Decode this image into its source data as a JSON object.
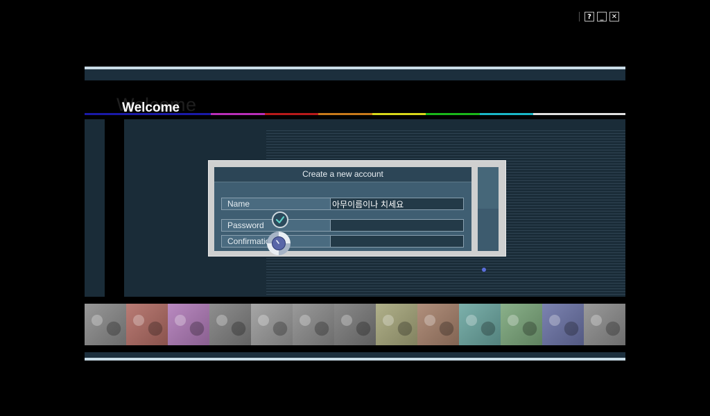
{
  "window_controls": [
    {
      "name": "help-button",
      "label": "?"
    },
    {
      "name": "minimize-button",
      "label": "_"
    },
    {
      "name": "close-button",
      "label": "✕"
    }
  ],
  "welcome": {
    "ghost_text": "Welcome",
    "title": "Welcome"
  },
  "rainbow_colors": [
    "#1a1aa8",
    "#1a1aa8",
    "#b82eb8",
    "#b81a1a",
    "#c87a1a",
    "#d8d81a",
    "#1ab81a",
    "#1ab8c8",
    "#e0e0e0"
  ],
  "dialog": {
    "header": "Create a new account",
    "fields": [
      {
        "label": "Name",
        "value": "아무이름이나 치세요"
      },
      {
        "label": "Password",
        "value": ""
      },
      {
        "label": "Confirmation",
        "value": ""
      }
    ],
    "ok_icon": "checkmark-icon",
    "dial_icon": "dial-icon"
  },
  "photo_strip": {
    "tints": [
      "#8a8a8a",
      "#b06a62",
      "#b07ab8",
      "#7f7f7f",
      "#9a9a9a",
      "#8c8c8c",
      "#7a7a7a",
      "#a6a67a",
      "#a6806a",
      "#6aa6a0",
      "#7aa67a",
      "#6a72a6",
      "#8c8c8c"
    ]
  }
}
